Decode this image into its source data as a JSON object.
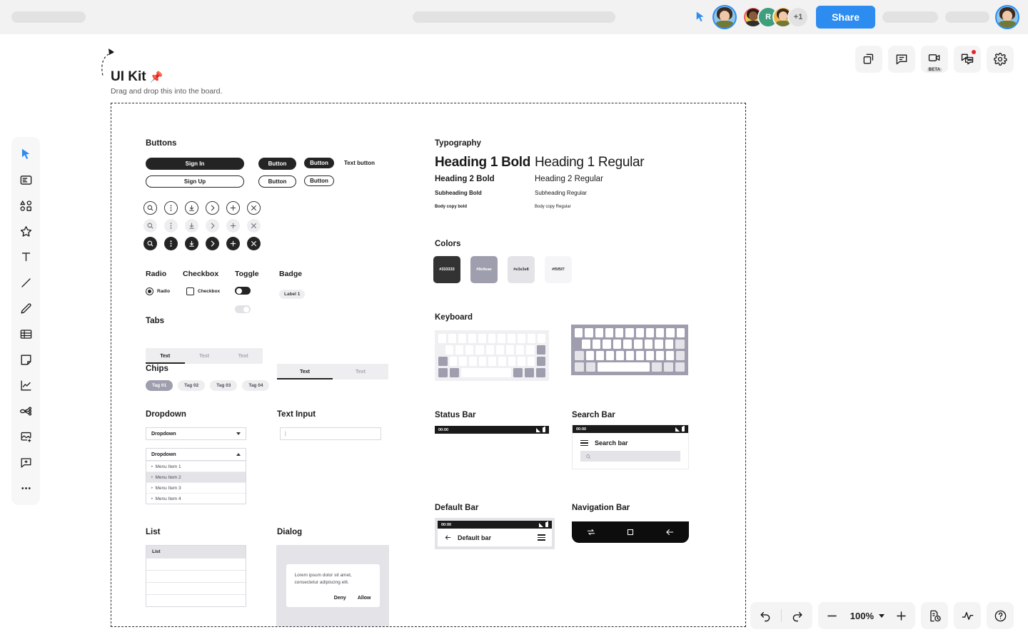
{
  "header": {
    "share_label": "Share",
    "avatar_overflow": "+1",
    "avatar_initial": "R",
    "accent_color": "#2d8cf0"
  },
  "right_tools": [
    {
      "name": "frames-icon",
      "label": ""
    },
    {
      "name": "comment-icon",
      "label": ""
    },
    {
      "name": "video-icon",
      "label": "BETA"
    },
    {
      "name": "chat-icon",
      "label": ""
    },
    {
      "name": "gear-icon",
      "label": ""
    }
  ],
  "left_tools": [
    {
      "name": "cursor-select-icon"
    },
    {
      "name": "template-icon"
    },
    {
      "name": "shapes-icon"
    },
    {
      "name": "star-icon"
    },
    {
      "name": "text-icon"
    },
    {
      "name": "line-icon"
    },
    {
      "name": "pen-icon"
    },
    {
      "name": "table-icon"
    },
    {
      "name": "sticky-note-icon"
    },
    {
      "name": "chart-icon"
    },
    {
      "name": "mindmap-icon"
    },
    {
      "name": "image-icon"
    },
    {
      "name": "comment-add-icon"
    },
    {
      "name": "more-icon"
    }
  ],
  "bottom_bar": {
    "undo": "undo-icon",
    "redo": "redo-icon",
    "zoom_out": "minus-icon",
    "zoom_level": "100%",
    "zoom_in": "plus-icon",
    "history": "history-icon",
    "activity": "activity-icon",
    "help": "help-icon"
  },
  "canvas": {
    "title": "UI Kit",
    "title_emoji": "📌",
    "subtitle": "Drag and drop this into the board."
  },
  "sections": {
    "buttons": {
      "title": "Buttons",
      "sign_in": "Sign In",
      "sign_up": "Sign Up",
      "button_label": "Button",
      "text_button": "Text button",
      "icons": [
        "search-icon",
        "more-vertical-icon",
        "download-icon",
        "chevron-right-icon",
        "plus-icon",
        "close-icon"
      ]
    },
    "controls": {
      "radio_title": "Radio",
      "radio_label": "Radio",
      "checkbox_title": "Checkbox",
      "checkbox_label": "Checkbox",
      "toggle_title": "Toggle",
      "badge_title": "Badge",
      "badge_label": "Label 1"
    },
    "tabs": {
      "title": "Tabs",
      "group_a": [
        "Text",
        "Text",
        "Text"
      ],
      "group_b": [
        "Text",
        "Text"
      ]
    },
    "chips": {
      "title": "Chips",
      "items": [
        "Tag 01",
        "Tag 02",
        "Tag 03",
        "Tag 04"
      ]
    },
    "dropdown": {
      "title": "Dropdown",
      "closed_value": "Dropdown",
      "open_value": "Dropdown",
      "menu_items": [
        "Menu Item 1",
        "Menu Item 2",
        "Menu Item 3",
        "Menu Item 4"
      ],
      "highlighted_index": 1
    },
    "text_input": {
      "title": "Text Input",
      "value": "",
      "placeholder": "|"
    },
    "list": {
      "title": "List",
      "header": "List",
      "rows": [
        "",
        "",
        "",
        ""
      ]
    },
    "dialog": {
      "title": "Dialog",
      "body": "Lorem ipsum dolor sit amet, consectetur adipiscing elit.",
      "deny": "Deny",
      "allow": "Allow"
    },
    "typography": {
      "title": "Typography",
      "rows": [
        {
          "bold": "Heading 1 Bold",
          "regular": "Heading 1 Regular"
        },
        {
          "bold": "Heading 2 Bold",
          "regular": "Heading 2 Regular"
        },
        {
          "bold": "Subheading Bold",
          "regular": "Subheading Regular"
        },
        {
          "bold": "Body copy bold",
          "regular": "Body copy Regular"
        }
      ]
    },
    "colors": {
      "title": "Colors",
      "swatches": [
        {
          "hex": "#333333",
          "text": "#ffffff"
        },
        {
          "hex": "#9e9eae",
          "text": "#ffffff"
        },
        {
          "hex": "#e3e3e8",
          "text": "#333333"
        },
        {
          "hex": "#f5f5f7",
          "text": "#333333"
        }
      ]
    },
    "keyboard": {
      "title": "Keyboard"
    },
    "status_bar": {
      "title": "Status Bar",
      "time": "00:00"
    },
    "search_bar": {
      "title": "Search Bar",
      "time": "00:00",
      "label": "Search bar",
      "field_placeholder": ""
    },
    "default_bar": {
      "title": "Default Bar",
      "time": "00:00",
      "label": "Default bar"
    },
    "navigation_bar": {
      "title": "Navigation Bar",
      "buttons": [
        "recents-icon",
        "home-icon",
        "back-icon"
      ]
    }
  }
}
